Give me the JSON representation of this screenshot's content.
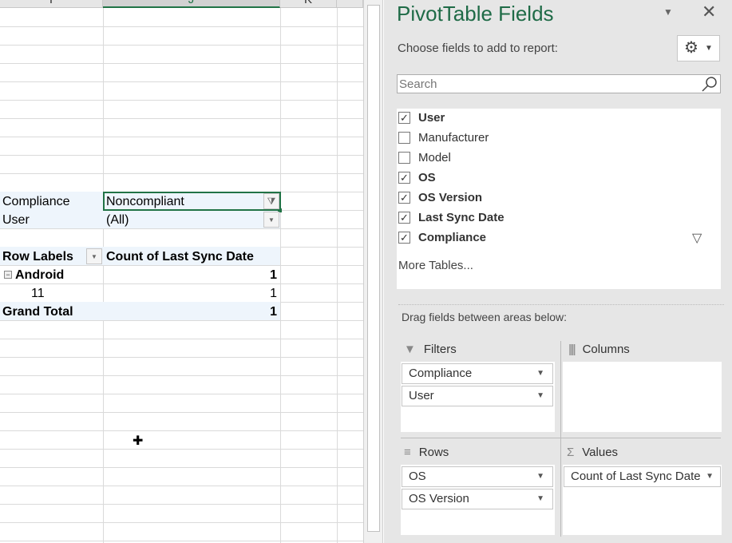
{
  "sheet": {
    "columns": [
      "I",
      "J",
      "K"
    ],
    "pivot": {
      "filters": [
        {
          "label": "Compliance",
          "value": "Noncompliant"
        },
        {
          "label": "User",
          "value": "(All)"
        }
      ],
      "row_labels_header": "Row Labels",
      "value_header": "Count of Last Sync Date",
      "rows": [
        {
          "label": "Android",
          "value": "1",
          "expand_icon": "minus-box-icon"
        },
        {
          "label": "11",
          "value": "1"
        }
      ],
      "grand_total": {
        "label": "Grand Total",
        "value": "1"
      }
    }
  },
  "panel": {
    "title": "PivotTable Fields",
    "choose_label": "Choose fields to add to report:",
    "search_placeholder": "Search",
    "fields": [
      {
        "name": "User",
        "checked": true
      },
      {
        "name": "Manufacturer",
        "checked": false
      },
      {
        "name": "Model",
        "checked": false
      },
      {
        "name": "OS",
        "checked": true
      },
      {
        "name": "OS Version",
        "checked": true
      },
      {
        "name": "Last Sync Date",
        "checked": true
      },
      {
        "name": "Compliance",
        "checked": true
      }
    ],
    "more_tables": "More Tables...",
    "drag_label": "Drag fields between areas below:",
    "areas": {
      "filters": {
        "label": "Filters",
        "items": [
          "Compliance",
          "User"
        ]
      },
      "columns": {
        "label": "Columns",
        "items": []
      },
      "rows": {
        "label": "Rows",
        "items": [
          "OS",
          "OS Version"
        ]
      },
      "values": {
        "label": "Values",
        "items": [
          "Count of Last Sync Date"
        ]
      }
    },
    "accent": "#1f6b47"
  }
}
